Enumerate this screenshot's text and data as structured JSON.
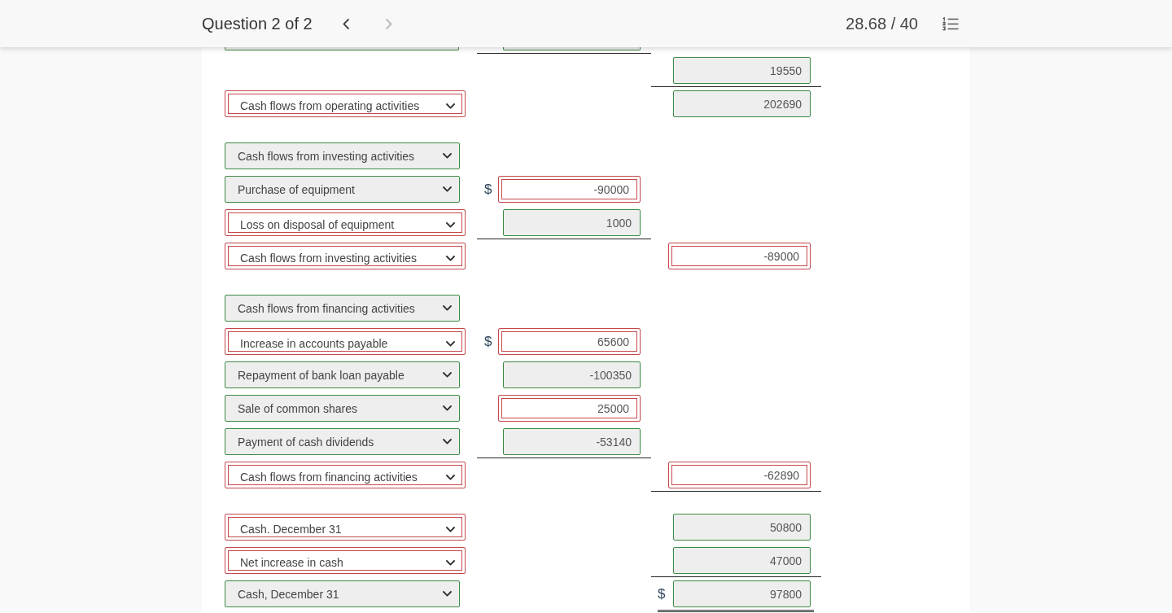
{
  "header": {
    "title": "Question 2 of 2",
    "previous": {
      "disabled": false
    },
    "next": {
      "disabled": true
    },
    "score": "28.68 / 40"
  },
  "statement": {
    "sections": [
      {
        "rows": [
          {
            "kind": "cut_off",
            "account": {
              "correct": true
            },
            "middle": {
              "correct": true
            },
            "middle_underline": true
          },
          {
            "kind": "line",
            "right": {
              "value": "19550",
              "correct": true
            },
            "right_underline": true
          },
          {
            "kind": "line",
            "account": {
              "label": "Cash flows from operating activities",
              "correct": false
            },
            "right": {
              "value": "202690",
              "correct": true
            }
          }
        ]
      },
      {
        "rows": [
          {
            "kind": "line",
            "account": {
              "label": "Cash flows from investing activities",
              "correct": true
            }
          },
          {
            "kind": "line",
            "account": {
              "label": "Purchase of equipment",
              "correct": true
            },
            "middle": {
              "currency": "$",
              "value": "-90000",
              "correct": false
            }
          },
          {
            "kind": "line",
            "account": {
              "label": "Loss on disposal of equipment",
              "correct": false
            },
            "middle": {
              "value": "1000",
              "correct": true
            },
            "middle_underline": true
          },
          {
            "kind": "line",
            "account": {
              "label": "Cash flows from investing activities",
              "correct": false
            },
            "right": {
              "value": "-89000",
              "correct": false
            }
          }
        ]
      },
      {
        "rows": [
          {
            "kind": "line",
            "account": {
              "label": "Cash flows from financing activities",
              "correct": true
            }
          },
          {
            "kind": "line",
            "account": {
              "label": "Increase in accounts payable",
              "correct": false
            },
            "middle": {
              "currency": "$",
              "value": "65600",
              "correct": false
            }
          },
          {
            "kind": "line",
            "account": {
              "label": "Repayment of bank loan payable",
              "correct": true
            },
            "middle": {
              "value": "-100350",
              "correct": true
            }
          },
          {
            "kind": "line",
            "account": {
              "label": "Sale of common shares",
              "correct": true
            },
            "middle": {
              "value": "25000",
              "correct": false
            }
          },
          {
            "kind": "line",
            "account": {
              "label": "Payment of cash dividends",
              "correct": true
            },
            "middle": {
              "value": "-53140",
              "correct": true
            },
            "middle_underline": true
          },
          {
            "kind": "line",
            "account": {
              "label": "Cash flows from financing activities",
              "correct": false
            },
            "right": {
              "value": "-62890",
              "correct": false
            },
            "right_underline": true
          }
        ]
      },
      {
        "rows": [
          {
            "kind": "line",
            "account": {
              "label": "Cash. December 31",
              "correct": false
            },
            "right": {
              "value": "50800",
              "correct": true
            }
          },
          {
            "kind": "line",
            "account": {
              "label": "Net increase in cash",
              "correct": false
            },
            "right": {
              "value": "47000",
              "correct": true
            },
            "right_underline": true
          },
          {
            "kind": "line",
            "account": {
              "label": "Cash, December 31",
              "correct": true
            },
            "right": {
              "currency": "$",
              "value": "97800",
              "correct": true
            },
            "right_double_underline": true
          }
        ]
      }
    ]
  }
}
